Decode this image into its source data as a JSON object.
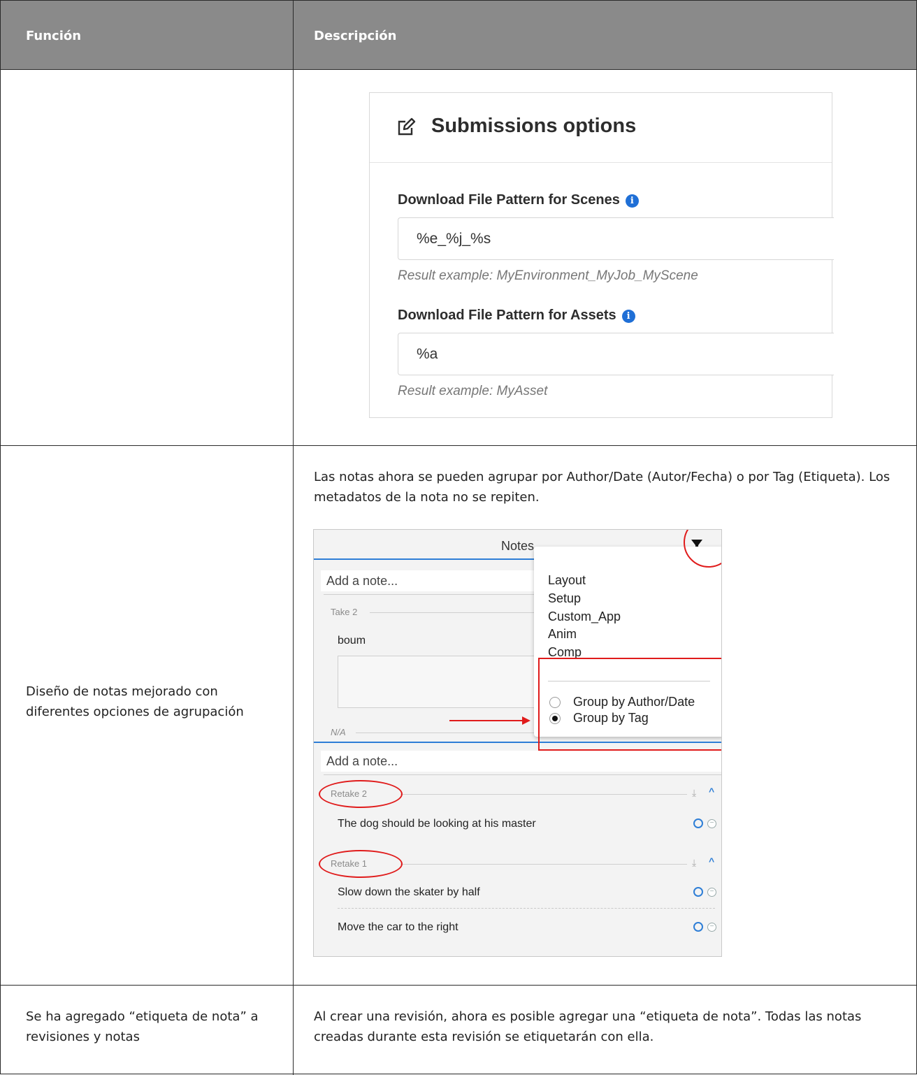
{
  "table": {
    "headers": {
      "function": "Función",
      "description": "Descripción"
    }
  },
  "submissions": {
    "title": "Submissions options",
    "fields": [
      {
        "label": "Download File Pattern for Scenes",
        "value": "%e_%j_%s",
        "hint": "Result example: MyEnvironment_MyJob_MyScene"
      },
      {
        "label": "Download File Pattern for Assets",
        "value": "%a",
        "hint": "Result example: MyAsset"
      }
    ]
  },
  "rows": {
    "notes_layout": {
      "function": "Diseño de notas mejorado con diferentes opciones de agrupación",
      "description": "Las notas ahora se pueden agrupar por Author/Date (Autor/Fecha) o por Tag (Etiqueta). Los metadatos de la nota no se repiten."
    },
    "note_tag": {
      "function": "Se ha agregado “etiqueta de nota” a revisiones y notas",
      "description": "Al crear una revisión, ahora es posible agregar una “etiqueta de nota”. Todas las notas creadas durante esta revisión se etiquetarán con ella."
    }
  },
  "notes_panel": {
    "title": "Notes",
    "add_note_placeholder": "Add a note...",
    "take2": {
      "label": "Take 2",
      "note": "boum"
    },
    "na_label": "N/A",
    "menu": {
      "tags": [
        "Layout",
        "Setup",
        "Custom_App",
        "Anim",
        "Comp"
      ],
      "group_by_author": "Group by Author/Date",
      "group_by_tag": "Group by Tag",
      "selected": "Group by Tag"
    },
    "groups": [
      {
        "label": "Retake 2",
        "notes": [
          "The dog should be looking at his master"
        ]
      },
      {
        "label": "Retake 1",
        "notes": [
          "Slow down the skater by half",
          "Move the car to the right"
        ]
      }
    ]
  },
  "colors": {
    "header_bg": "#8a8a8a",
    "accent_blue": "#2e7ed6",
    "annotation_red": "#e01b1b",
    "info_blue": "#1f6fd6"
  },
  "icons": [
    "edit-icon",
    "info-icon",
    "filter-icon",
    "download-icon",
    "chevron-up-icon",
    "circle-icon",
    "minus-circle-icon"
  ]
}
